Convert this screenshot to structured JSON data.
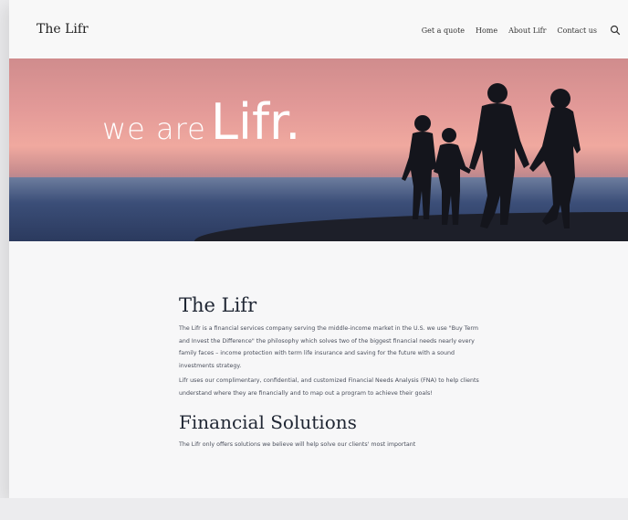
{
  "header": {
    "brand": "The Lifr",
    "nav": [
      "Get a quote",
      "Home",
      "About Lifr",
      "Contact us"
    ]
  },
  "hero": {
    "title_small": "we are",
    "title_big": "Lifr."
  },
  "main": {
    "heading": "The Lifr",
    "para1": "The Lifr is a financial services company serving the middle-income market in the U.S. we use \"Buy Term and Invest the Difference\" the philosophy which solves two of the biggest financial needs nearly every family faces – income protection with term life insurance and saving for the future with a sound investments strategy.",
    "para2": "Lifr uses our complimentary, confidential, and customized Financial Needs Analysis (FNA) to help clients understand where they are financially and to map out a program to achieve their goals!",
    "heading2": "Financial Solutions",
    "para3": "The Lifr only offers solutions we believe will help solve our clients' most important"
  },
  "colors": {
    "brand_text": "#222222",
    "heading": "#1f2633",
    "body_text": "#4a4f5c"
  }
}
